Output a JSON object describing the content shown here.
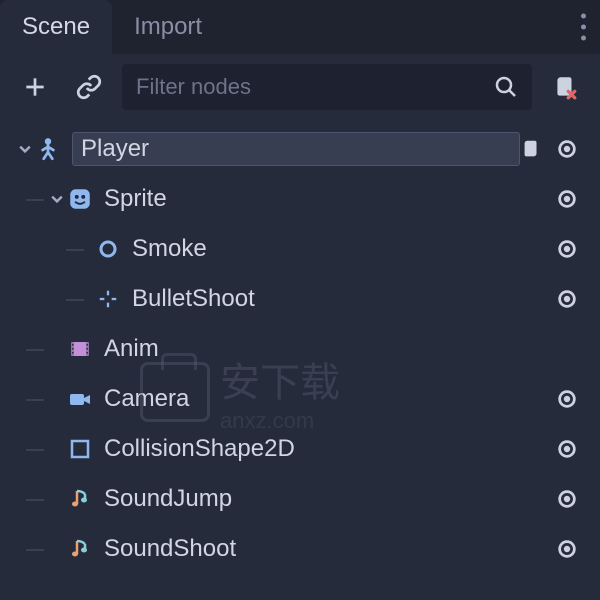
{
  "tabs": {
    "scene": "Scene",
    "import": "Import"
  },
  "filter": {
    "placeholder": "Filter nodes"
  },
  "tree": {
    "nodes": [
      {
        "label": "Player"
      },
      {
        "label": "Sprite"
      },
      {
        "label": "Smoke"
      },
      {
        "label": "BulletShoot"
      },
      {
        "label": "Anim"
      },
      {
        "label": "Camera"
      },
      {
        "label": "CollisionShape2D"
      },
      {
        "label": "SoundJump"
      },
      {
        "label": "SoundShoot"
      }
    ]
  },
  "watermark": {
    "text": "安下载",
    "url": "anxz.com"
  },
  "colors": {
    "blue": "#8fb8f0",
    "purple": "#c28fd8",
    "cyan": "#88d0d8",
    "yellow": "#e0c96a",
    "orange": "#e8a170",
    "white": "#e5e8f0"
  }
}
